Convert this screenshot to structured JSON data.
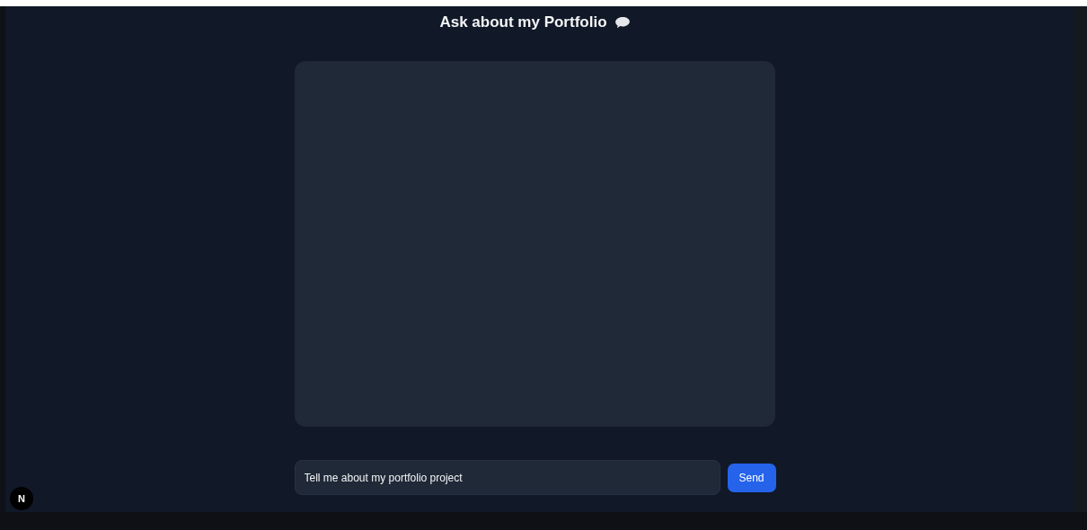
{
  "header": {
    "title": "Ask about my Portfolio"
  },
  "chat": {
    "messages_area": {
      "kind": "empty"
    }
  },
  "composer": {
    "value": "Tell me about my portfolio project",
    "send_button": "Send"
  },
  "dev_badge": {
    "label": "N"
  }
}
